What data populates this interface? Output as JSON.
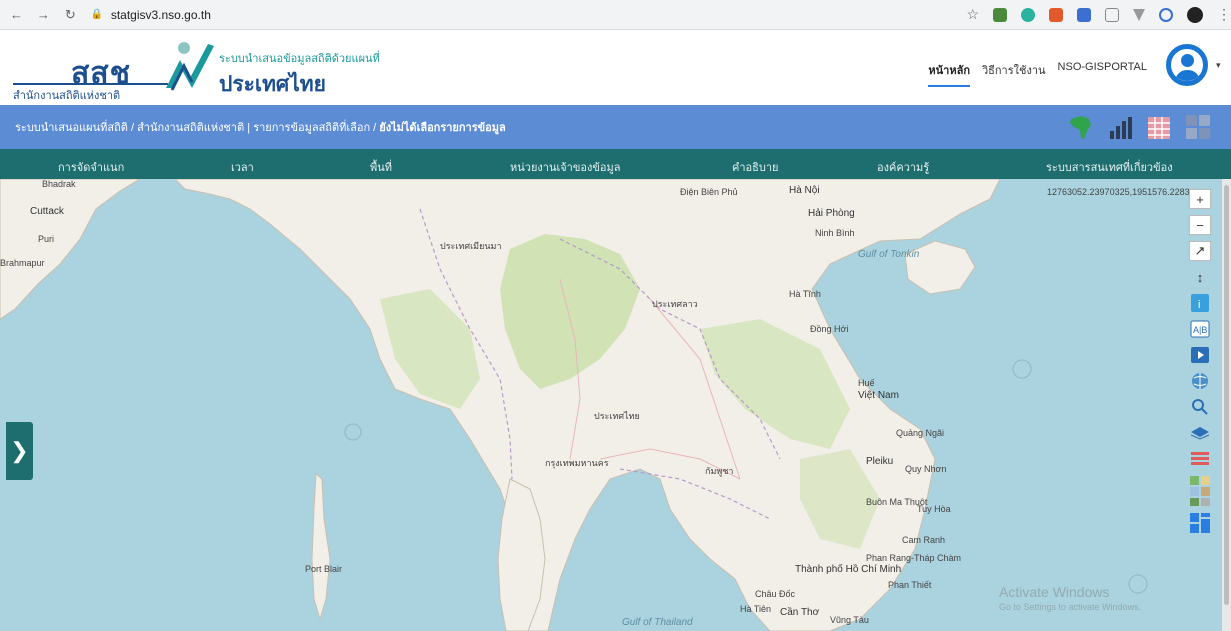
{
  "browser": {
    "url": "statgisv3.nso.go.th"
  },
  "header": {
    "logo_text": "สสช",
    "logo_subtitle": "สำนักงานสถิติแห่งชาติ",
    "title_small": "ระบบนำเสนอข้อมูลสถิติด้วยแผนที่",
    "title_big": "ประเทศไทย",
    "links": [
      "หน้าหลัก",
      "วิธีการใช้งาน",
      "NSO-GISPORTAL"
    ]
  },
  "breadcrumb": {
    "text": "ระบบนำเสนอแผนที่สถิติ / สำนักงานสถิติแห่งชาติ | รายการข้อมูลสถิติที่เลือก / ",
    "current": "ยังไม่ได้เลือกรายการข้อมูล"
  },
  "menu": [
    "การจัดจำแนก",
    "เวลา",
    "พื้นที่",
    "หน่วยงานเจ้าของข้อมูล",
    "คำอธิบาย",
    "องค์ความรู้",
    "ระบบสารสนเทศที่เกี่ยวข้อง"
  ],
  "map": {
    "coordinate_readout": "12763052.23970325,1951576.2283",
    "watermark_title": "Activate Windows",
    "watermark_sub": "Go to Settings to activate Windows.",
    "labels": {
      "bhadrak": "Bhadrak",
      "cuttack": "Cuttack",
      "puri": "Puri",
      "brahmapur": "Brahmapur",
      "hanoi": "Hà Nội",
      "haiphong": "Hải Phòng",
      "ninhbinh": "Ninh Bình",
      "dienbien": "Điện Biên Phủ",
      "gulf_tonkin": "Gulf of Tonkin",
      "hatinh": "Hà Tĩnh",
      "donghoi": "Đồng Hới",
      "hue": "Huế",
      "vietnam": "Việt Nam",
      "quangngai": "Quảng Ngãi",
      "pleiku": "Pleiku",
      "quynhon": "Quy Nhơn",
      "buonma": "Buôn Ma Thuột",
      "tuyhoa": "Tuy Hòa",
      "camranh": "Cam Ranh",
      "phanrang": "Phan Rang-Tháp Chàm",
      "phanthiet": "Phan Thiết",
      "hcm": "Thành phố Hồ Chí Minh",
      "chaudoc": "Châu Đốc",
      "hatien": "Hà Tiên",
      "cantho": "Cần Thơ",
      "vungtau": "Vũng Tàu",
      "gulf_thailand": "Gulf of Thailand",
      "portblair": "Port Blair",
      "thailand": "ประเทศไทย",
      "bangkok": "กรุงเทพมหานคร",
      "myanmar_area": "ประเทศเมียนมา",
      "laos_area": "ประเทศลาว",
      "cambodia_area": "กัมพูชา"
    }
  },
  "toolbar_icons": [
    "plus-icon",
    "minus-icon",
    "fullscreen-icon",
    "scale-icon",
    "info-icon",
    "swipe-icon",
    "play-icon",
    "globe-icon",
    "search-icon",
    "layers-icon",
    "legend-icon",
    "basemap-icon",
    "dashboard-icon"
  ],
  "colors": {
    "crumb_bar": "#5b8cd4",
    "menu_bar": "#1e6e70",
    "sea": "#aad3df",
    "land": "#f2efe9",
    "forest": "#c8dfa8"
  }
}
